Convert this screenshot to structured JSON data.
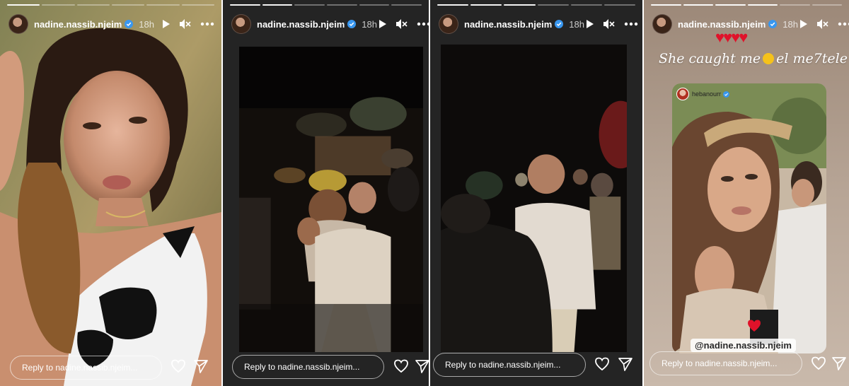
{
  "stories": [
    {
      "username": "nadine.nassib.njeim",
      "age": "18h",
      "reply_placeholder": "Reply to nadine.nassib.njeim..."
    },
    {
      "username": "nadine.nassib.njeim",
      "age": "18h",
      "reply_placeholder": "Reply to nadine.nassib.njeim..."
    },
    {
      "username": "nadine.nassib.njeim",
      "age": "18h",
      "reply_placeholder": "Reply to nadine.nassib.njeim..."
    },
    {
      "username": "nadine.nassib.njeim",
      "age": "18h",
      "reply_placeholder": "Reply to nadine.nassib.njeim...",
      "caption_before": "She caught me",
      "caption_after": "el me7tele",
      "hearts": "♥♥♥♥",
      "repost_username": "hebanourr",
      "mention": "@nadine.nassib.njeim"
    }
  ],
  "icons": {
    "play": "play-icon",
    "mute": "speaker-muted-icon",
    "more": "more-icon",
    "like": "heart-icon",
    "share": "send-icon",
    "verified": "verified-badge-icon"
  },
  "colors": {
    "heart": "#e0122a",
    "verified": "#3897f0"
  }
}
